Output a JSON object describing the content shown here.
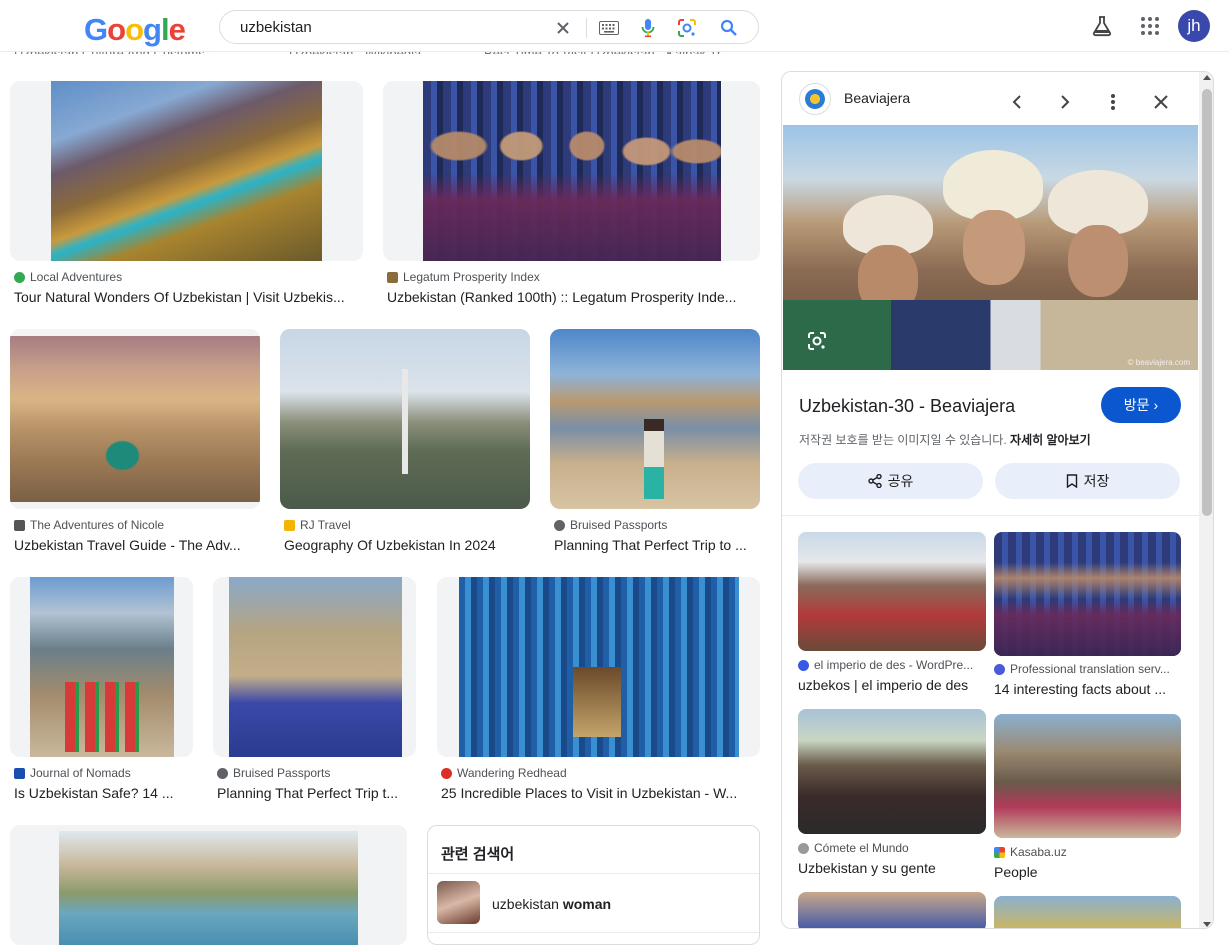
{
  "header": {
    "logo_letters": [
      "G",
      "o",
      "o",
      "g",
      "l",
      "e"
    ],
    "search_value": "uzbekistan",
    "avatar": "jh",
    "icons": [
      "clear-icon",
      "keyboard-icon",
      "mic-icon",
      "lens-icon",
      "search-icon",
      "labs-icon",
      "apps-icon"
    ]
  },
  "cutoff_row": [
    "Uzbekistan Culture And Customs - ...",
    "Uzbekistan - Wikipedia",
    "Best Time To Visit Uzbekistan - Kalpak Tr..."
  ],
  "results": [
    {
      "source": "Local Adventures",
      "title": "Tour Natural Wonders Of Uzbekistan | Visit Uzbekis..."
    },
    {
      "source": "Legatum Prosperity Index",
      "title": "Uzbekistan (Ranked 100th) :: Legatum Prosperity Inde..."
    },
    {
      "source": "The Adventures of Nicole",
      "title": "Uzbekistan Travel Guide - The Adv..."
    },
    {
      "source": "RJ Travel",
      "title": "Geography Of Uzbekistan In 2024"
    },
    {
      "source": "Bruised Passports",
      "title": "Planning That Perfect Trip to ..."
    },
    {
      "source": "Journal of Nomads",
      "title": "Is Uzbekistan Safe? 14 ..."
    },
    {
      "source": "Bruised Passports",
      "title": "Planning That Perfect Trip t..."
    },
    {
      "source": "Wandering Redhead",
      "title": "25 Incredible Places to Visit in Uzbekistan - W..."
    }
  ],
  "related": {
    "heading": "관련 검색어",
    "item_prefix": "uzbekistan",
    "item_bold": "woman"
  },
  "panel": {
    "site": "Beaviajera",
    "title": "Uzbekistan-30 - Beaviajera",
    "visit": "방문",
    "copyright": "저작권 보호를 받는 이미지일 수 있습니다.",
    "learn_more": "자세히 알아보기",
    "share": "공유",
    "save": "저장",
    "watermark": "© beaviajera.com",
    "similar": [
      {
        "source": "el imperio de des - WordPre...",
        "title": "uzbekos | el imperio de des"
      },
      {
        "source": "Professional translation serv...",
        "title": "14 interesting facts about ..."
      },
      {
        "source": "Cómete el Mundo",
        "title": "Uzbekistan y su gente"
      },
      {
        "source": "Kasaba.uz",
        "title": "People"
      }
    ]
  },
  "colors": {
    "blue": "#4285f4",
    "red": "#ea4335",
    "yellow": "#fbbc05",
    "green": "#34a853",
    "visit_btn": "#0b57d0"
  }
}
